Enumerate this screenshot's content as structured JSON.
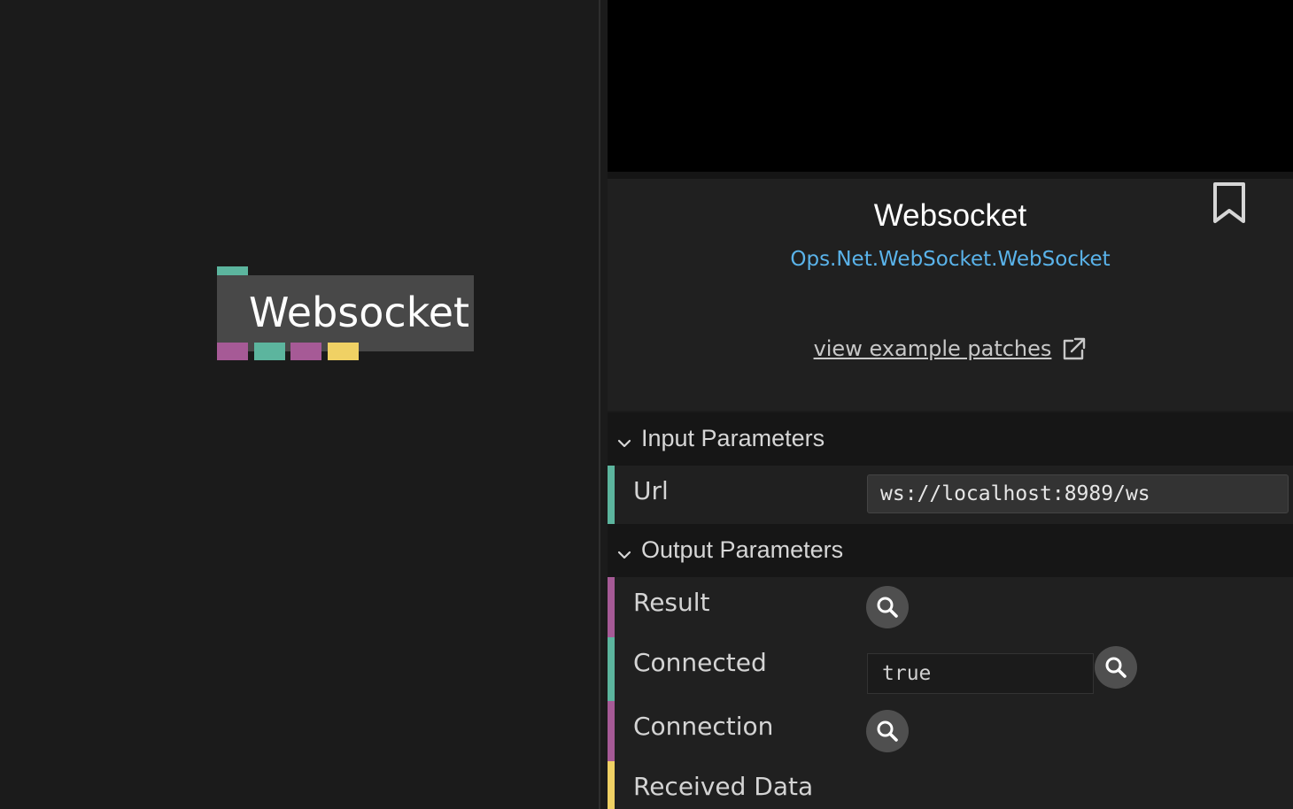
{
  "canvas": {
    "op_node_title": "Websocket"
  },
  "colors": {
    "string_port": "#5cb59e",
    "object_port": "#a65a96",
    "trigger_port": "#f0d164",
    "link": "#5ab3ea"
  },
  "op_info": {
    "title": "Websocket",
    "namespace": "Ops.Net.WebSocket.WebSocket",
    "examples_link": "view example patches",
    "bookmark_icon": "bookmark-icon",
    "external_icon": "external-link-icon"
  },
  "input_section": {
    "label": "Input Parameters",
    "params": [
      {
        "name": "Url",
        "value": "ws://localhost:8989/ws"
      }
    ]
  },
  "output_section": {
    "label": "Output Parameters",
    "params": [
      {
        "name": "Result",
        "value": ""
      },
      {
        "name": "Connected",
        "value": "true"
      },
      {
        "name": "Connection",
        "value": ""
      },
      {
        "name": "Received Data",
        "value": ""
      }
    ]
  }
}
